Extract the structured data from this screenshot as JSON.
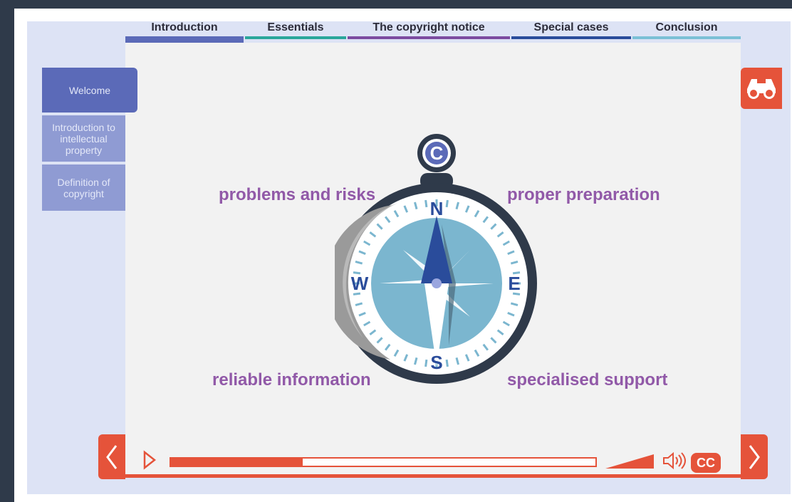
{
  "tabs": [
    {
      "label": "Introduction",
      "color": "#5b6ab8",
      "active": true
    },
    {
      "label": "Essentials",
      "color": "#2aa79b",
      "active": false
    },
    {
      "label": "The copyright notice",
      "color": "#7c4ba0",
      "active": false
    },
    {
      "label": "Special cases",
      "color": "#2a4c9b",
      "active": false
    },
    {
      "label": "Conclusion",
      "color": "#7bc0d6",
      "active": false
    }
  ],
  "sidebar": {
    "items": [
      {
        "label": "Welcome",
        "active": true
      },
      {
        "label": "Introduction to intellectual property",
        "active": false
      },
      {
        "label": "Definition of copyright",
        "active": false
      }
    ]
  },
  "compass": {
    "symbol": "C",
    "north": "N",
    "south": "S",
    "east": "E",
    "west": "W",
    "labels": {
      "top_left": "problems and risks",
      "top_right": "proper preparation",
      "bottom_left": "reliable information",
      "bottom_right": "specialised support"
    }
  },
  "player": {
    "progress": 0.31,
    "cc_label": "CC",
    "icons": {
      "prev": "chevron-left-icon",
      "play": "play-icon",
      "volume": "volume-icon",
      "next": "chevron-right-icon",
      "search": "binoculars-icon"
    }
  },
  "colors": {
    "accent": "#e5533a",
    "label_purple": "#9159a8",
    "compass_dark": "#2f3a4a"
  }
}
